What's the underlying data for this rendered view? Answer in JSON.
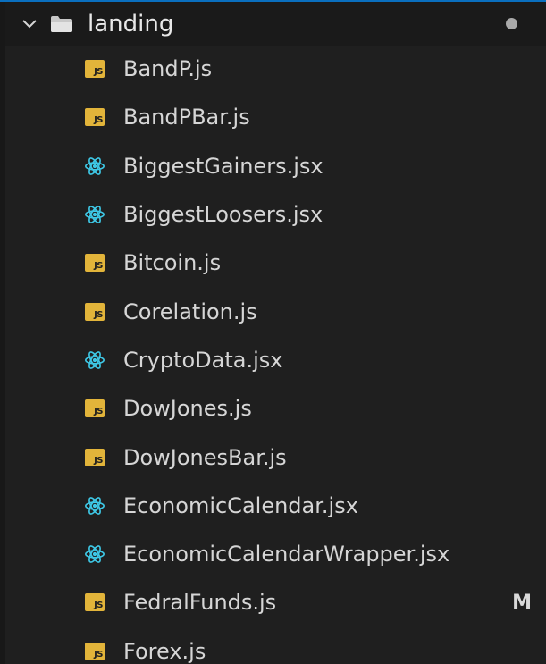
{
  "folder": {
    "name": "landing",
    "expanded": true,
    "chevron_icon": "chevron-down-icon",
    "folder_icon": "folder-open-icon",
    "has_modified_indicator": true
  },
  "files": [
    {
      "name": "BandP.js",
      "icon": "js-icon",
      "badge": "JS",
      "status": ""
    },
    {
      "name": "BandPBar.js",
      "icon": "js-icon",
      "badge": "JS",
      "status": ""
    },
    {
      "name": "BiggestGainers.jsx",
      "icon": "react-icon",
      "badge": "",
      "status": ""
    },
    {
      "name": "BiggestLoosers.jsx",
      "icon": "react-icon",
      "badge": "",
      "status": ""
    },
    {
      "name": "Bitcoin.js",
      "icon": "js-icon",
      "badge": "JS",
      "status": ""
    },
    {
      "name": "Corelation.js",
      "icon": "js-icon",
      "badge": "JS",
      "status": ""
    },
    {
      "name": "CryptoData.jsx",
      "icon": "react-icon",
      "badge": "",
      "status": ""
    },
    {
      "name": "DowJones.js",
      "icon": "js-icon",
      "badge": "JS",
      "status": ""
    },
    {
      "name": "DowJonesBar.js",
      "icon": "js-icon",
      "badge": "JS",
      "status": ""
    },
    {
      "name": "EconomicCalendar.jsx",
      "icon": "react-icon",
      "badge": "",
      "status": ""
    },
    {
      "name": "EconomicCalendarWrapper.jsx",
      "icon": "react-icon",
      "badge": "",
      "status": ""
    },
    {
      "name": "FedralFunds.js",
      "icon": "js-icon",
      "badge": "JS",
      "status": "M"
    },
    {
      "name": "Forex.js",
      "icon": "js-icon",
      "badge": "JS",
      "status": ""
    }
  ],
  "colors": {
    "background": "#1f1f1f",
    "text": "#d6d6d6",
    "js_badge": "#e2b43a",
    "react": "#3ec8e6",
    "focus_border": "#0a6fbf"
  }
}
